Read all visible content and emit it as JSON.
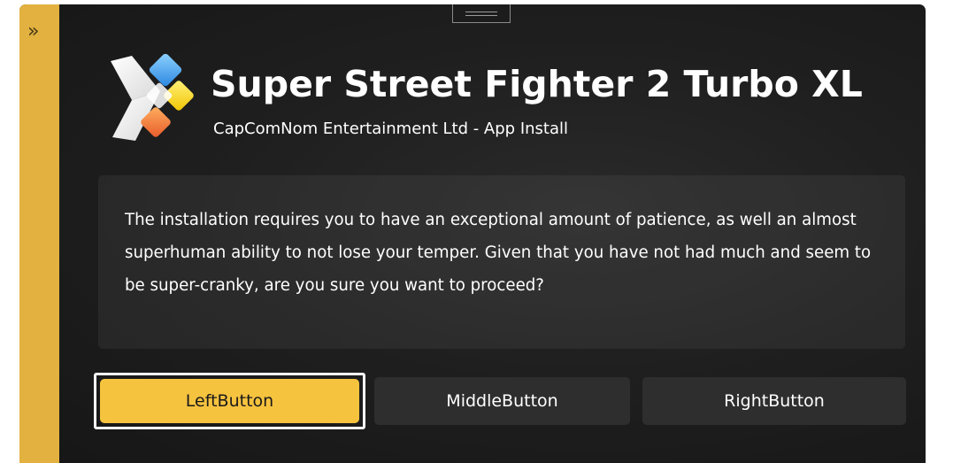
{
  "app": {
    "title": "Super Street Fighter 2 Turbo XL",
    "subtitle": "CapComNom Entertainment Ltd - App Install",
    "logo_icon": "app-logo-icon"
  },
  "sidebar": {
    "icon": "double-chevron-right-icon",
    "glyph": "»",
    "color": "#e2b13f"
  },
  "message": {
    "text": "The installation requires you to have an exceptional amount of patience, as well an almost superhuman ability to not lose your temper. Given that you have not had much and seem to be super-cranky, are you sure you want to proceed?"
  },
  "buttons": {
    "left": "LeftButton",
    "middle": "MiddleButton",
    "right": "RightButton"
  },
  "colors": {
    "accent": "#f6c33f",
    "background": "#1f1f1f",
    "button": "#2e2e2e"
  }
}
